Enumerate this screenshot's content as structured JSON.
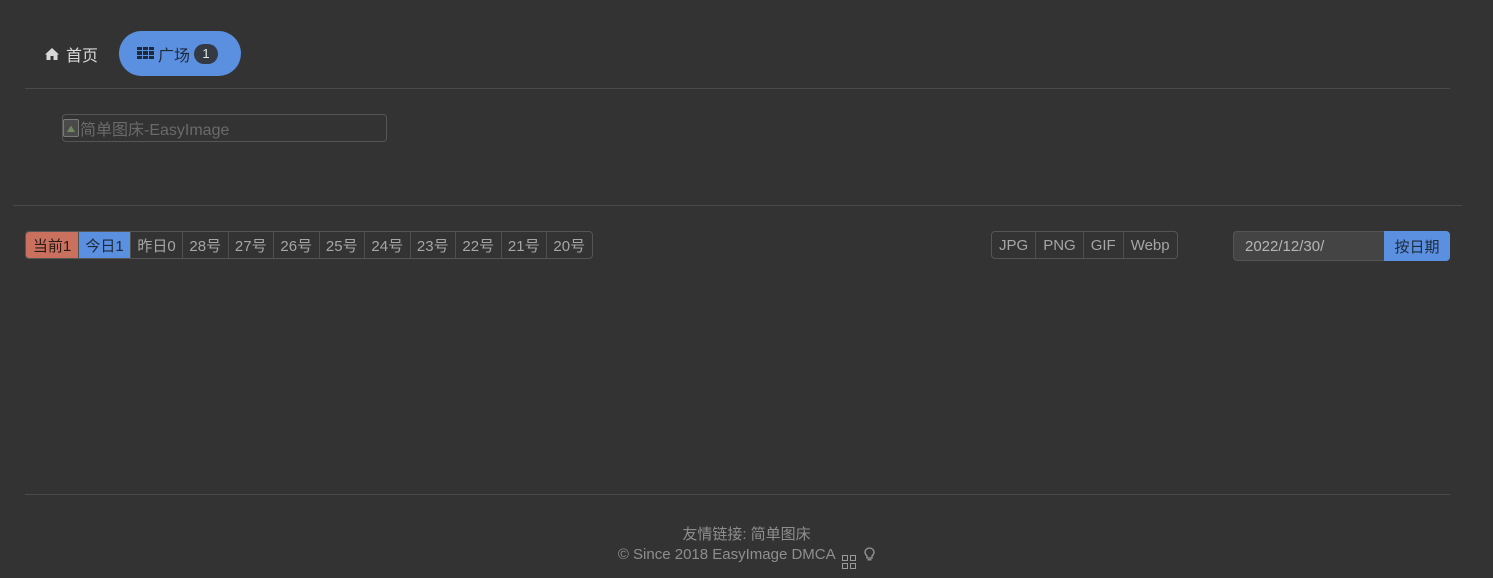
{
  "nav": {
    "home_label": "首页",
    "square_label": "广场",
    "square_badge": "1"
  },
  "logo": {
    "alt": "简单图床-EasyImage"
  },
  "date_filters": [
    {
      "label": "当前1",
      "state": "current"
    },
    {
      "label": "今日1",
      "state": "today"
    },
    {
      "label": "昨日0",
      "state": "normal"
    },
    {
      "label": "28号",
      "state": "normal"
    },
    {
      "label": "27号",
      "state": "normal"
    },
    {
      "label": "26号",
      "state": "normal"
    },
    {
      "label": "25号",
      "state": "normal"
    },
    {
      "label": "24号",
      "state": "normal"
    },
    {
      "label": "23号",
      "state": "normal"
    },
    {
      "label": "22号",
      "state": "normal"
    },
    {
      "label": "21号",
      "state": "normal"
    },
    {
      "label": "20号",
      "state": "normal"
    }
  ],
  "type_filters": [
    "JPG",
    "PNG",
    "GIF",
    "Webp"
  ],
  "date_search": {
    "value": "2022/12/30/",
    "button_label": "按日期"
  },
  "footer": {
    "links_prefix": "友情链接:",
    "link_text": "简单图床",
    "copyright": "© Since 2018 EasyImage DMCA"
  },
  "colors": {
    "background": "#333333",
    "accent_blue": "#5b8fdf",
    "accent_red": "#c9705f"
  },
  "icons": {
    "home": "home-icon",
    "square": "grid-icon",
    "footer_1": "qrcode-icon",
    "footer_2": "lightbulb-icon"
  }
}
